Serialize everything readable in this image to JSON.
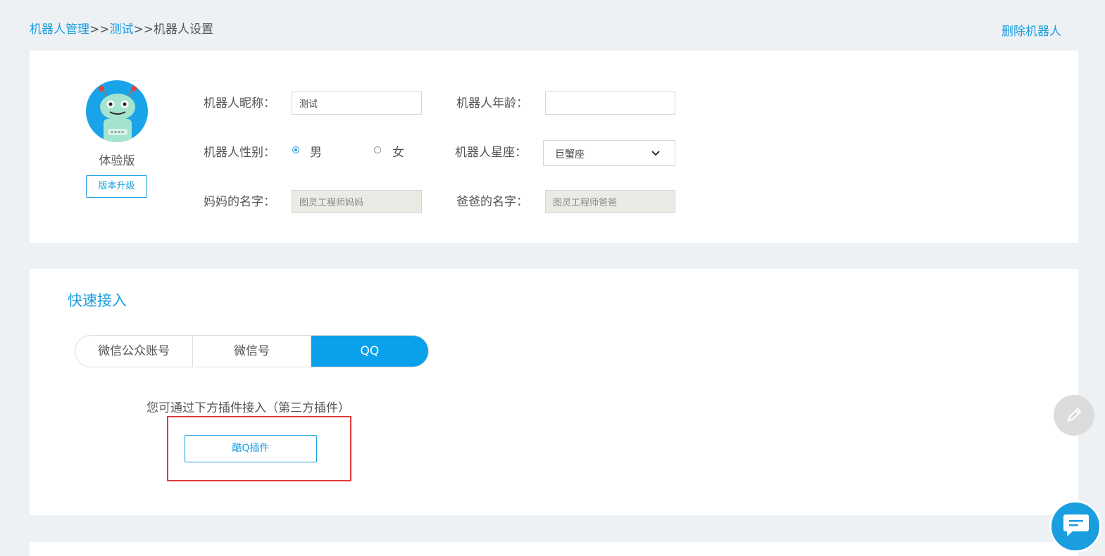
{
  "breadcrumb": {
    "robot_management": "机器人管理",
    "sep1": ">>",
    "robot_name": "测试",
    "sep2": ">>",
    "current": "机器人设置"
  },
  "header": {
    "delete_label": "删除机器人"
  },
  "profile": {
    "edition": "体验版",
    "upgrade_label": "版本升级",
    "nickname": {
      "label": "机器人昵称：",
      "value": "测试"
    },
    "age": {
      "label": "机器人年龄：",
      "value": ""
    },
    "gender": {
      "label": "机器人性别：",
      "male": "男",
      "female": "女",
      "selected": "男"
    },
    "constellation": {
      "label": "机器人星座：",
      "value": "巨蟹座"
    },
    "mother": {
      "label": "妈妈的名字：",
      "value": "图灵工程师妈妈"
    },
    "father": {
      "label": "爸爸的名字：",
      "value": "图灵工程师爸爸"
    }
  },
  "quick_access": {
    "title": "快速接入",
    "tabs": [
      {
        "label": "微信公众账号"
      },
      {
        "label": "微信号"
      },
      {
        "label": "QQ",
        "active": true
      }
    ],
    "hint": "您可通过下方插件接入（第三方插件）",
    "plugin_button": "酷Q插件"
  },
  "colors": {
    "accent": "#1a9ee0",
    "active_tab": "#0aa0ea",
    "highlight": "#e03a3a",
    "background": "#eef1f4"
  },
  "icons": {
    "avatar": "robot-avatar-icon",
    "edit": "pencil-icon",
    "chat": "chat-bubble-icon",
    "select": "chevron-down-icon"
  }
}
